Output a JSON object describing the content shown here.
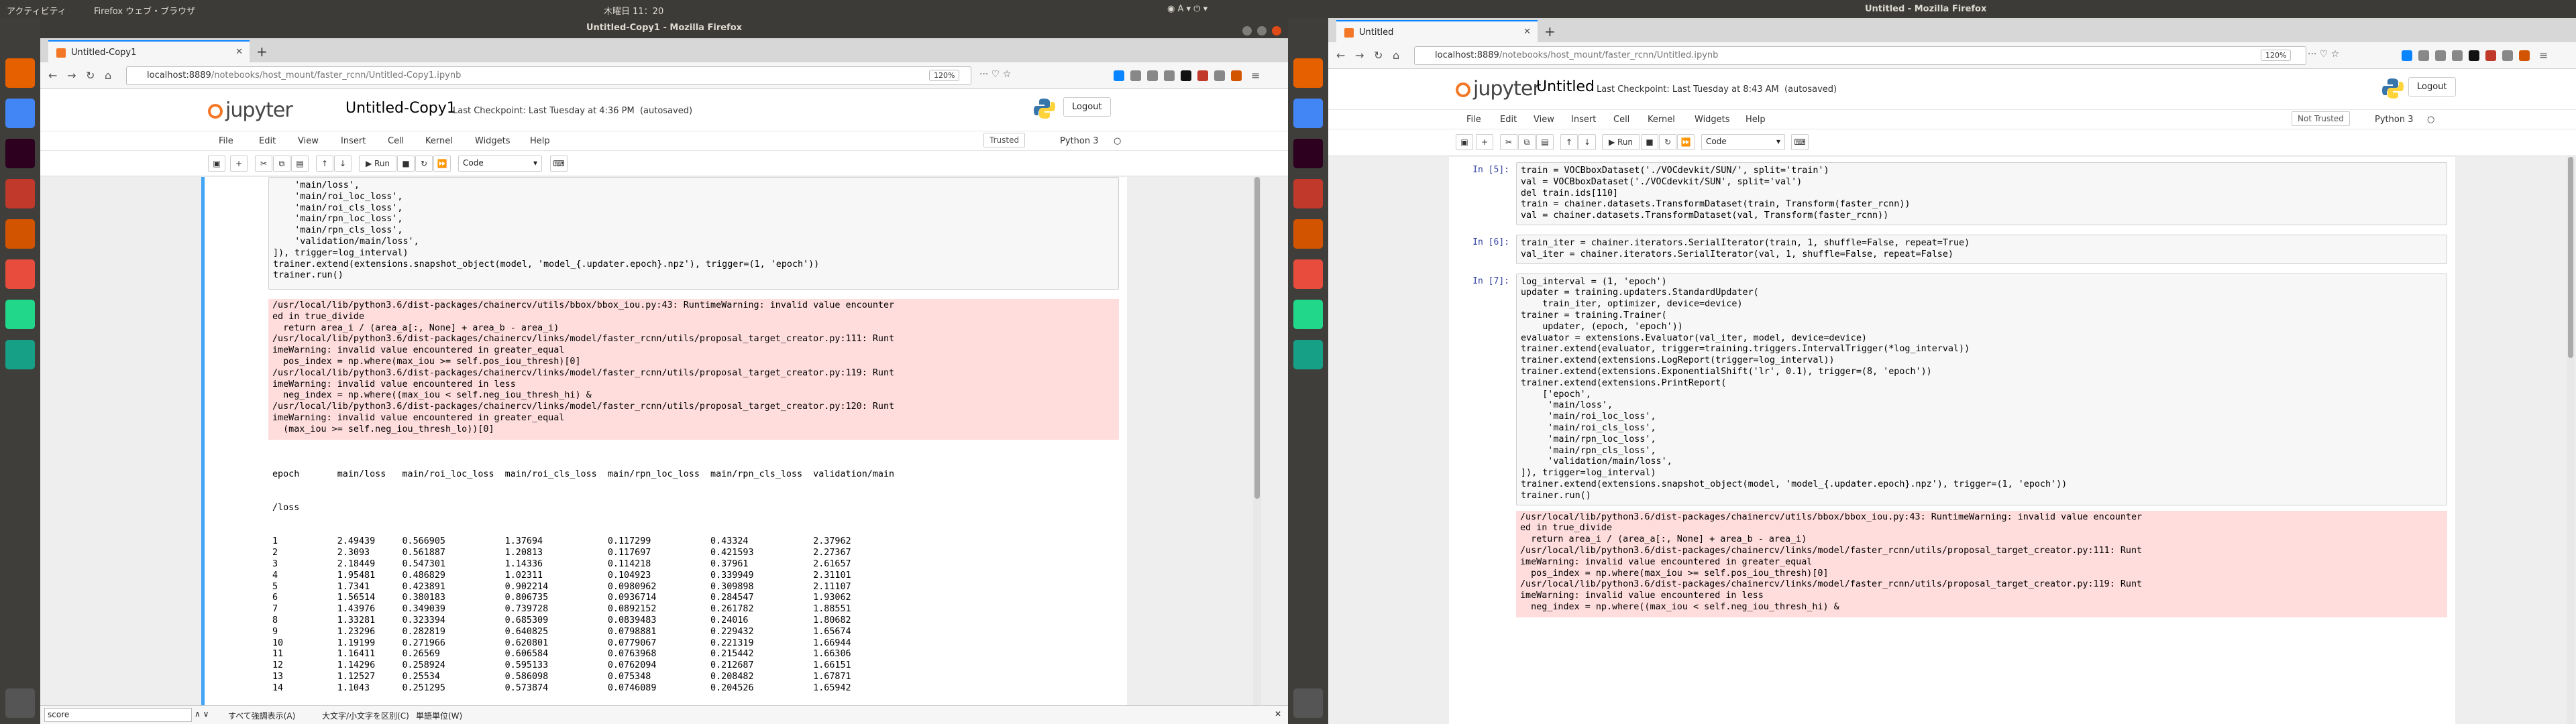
{
  "left": {
    "topbar": {
      "activities": "アクティビティ",
      "app": "Firefox ウェブ・ブラウザ",
      "clock": "木曜日 11：20"
    },
    "window_title": "Untitled-Copy1 - Mozilla Firefox",
    "tab_title": "Untitled-Copy1",
    "url_host": "localhost:8889",
    "url_path": "/notebooks/host_mount/faster_rcnn/Untitled-Copy1.ipynb",
    "zoom": "120%",
    "notebook_name": "Untitled-Copy1",
    "checkpoint": "Last Checkpoint: Last Tuesday at 4:36 PM",
    "autosaved": "(autosaved)",
    "logout": "Logout",
    "kernel_status": "Trusted",
    "kernel_name": "Python 3",
    "cell_type": "Code",
    "run_label": "Run",
    "code_lines": [
      "    'main/loss',",
      "    'main/roi_loc_loss',",
      "    'main/roi_cls_loss',",
      "    'main/rpn_loc_loss',",
      "    'main/rpn_cls_loss',",
      "    'validation/main/loss',",
      "]), trigger=log_interval)",
      "trainer.extend(extensions.snapshot_object(model, 'model_{.updater.epoch}.npz'), trigger=(1, 'epoch'))",
      "trainer.run()"
    ],
    "stderr_lines": [
      "/usr/local/lib/python3.6/dist-packages/chainercv/utils/bbox/bbox_iou.py:43: RuntimeWarning: invalid value encounter",
      "ed in true_divide",
      "  return area_i / (area_a[:, None] + area_b - area_i)",
      "/usr/local/lib/python3.6/dist-packages/chainercv/links/model/faster_rcnn/utils/proposal_target_creator.py:111: Runt",
      "imeWarning: invalid value encountered in greater_equal",
      "  pos_index = np.where(max_iou >= self.pos_iou_thresh)[0]",
      "/usr/local/lib/python3.6/dist-packages/chainercv/links/model/faster_rcnn/utils/proposal_target_creator.py:119: Runt",
      "imeWarning: invalid value encountered in less",
      "  neg_index = np.where((max_iou < self.neg_iou_thresh_hi) &",
      "/usr/local/lib/python3.6/dist-packages/chainercv/links/model/faster_rcnn/utils/proposal_target_creator.py:120: Runt",
      "imeWarning: invalid value encountered in greater_equal",
      "  (max_iou >= self.neg_iou_thresh_lo))[0]"
    ],
    "table_header": "epoch       main/loss   main/roi_loc_loss  main/roi_cls_loss  main/rpn_loc_loss  main/rpn_cls_loss  validation/main",
    "table_header2": "/loss",
    "table_rows": [
      "1           2.49439     0.566905           1.37694            0.117299           0.43324            2.37962",
      "2           2.3093      0.561887           1.20813            0.117697           0.421593           2.27367",
      "3           2.18449     0.547301           1.14336            0.114218           0.37961            2.61657",
      "4           1.95481     0.486829           1.02311            0.104923           0.339949           2.31101",
      "5           1.7341      0.423891           0.902214           0.0980962          0.309898           2.11107",
      "6           1.56514     0.380183           0.806735           0.0936714          0.284547           1.93062",
      "7           1.43976     0.349039           0.739728           0.0892152          0.261782           1.88551",
      "8           1.33281     0.323394           0.685309           0.0839483          0.24016            1.80682",
      "9           1.23296     0.282819           0.640825           0.0798881          0.229432           1.65674",
      "10          1.19199     0.271966           0.620801           0.0779067          0.221319           1.66944",
      "11          1.16411     0.26569            0.606584           0.0763968          0.215442           1.66306",
      "12          1.14296     0.258924           0.595133           0.0762094          0.212687           1.66151",
      "13          1.12527     0.25534            0.586098           0.075348           0.208482           1.67871",
      "14          1.1043      0.251295           0.573874           0.0746089          0.204526           1.65942"
    ],
    "find": {
      "value": "score",
      "highlight_all": "すべて強調表示(A)",
      "match_case": "大文字/小文字を区別(C)",
      "whole_words": "単語単位(W)"
    },
    "menu": [
      "File",
      "Edit",
      "View",
      "Insert",
      "Cell",
      "Kernel",
      "Widgets",
      "Help"
    ]
  },
  "right": {
    "topbar": {
      "title": "Untitled - Mozilla Firefox"
    },
    "window_title": "Untitled - Mozilla Firefox",
    "tab_title": "Untitled",
    "url_host": "localhost:8889",
    "url_path": "/notebooks/host_mount/faster_rcnn/Untitled.ipynb",
    "zoom": "120%",
    "notebook_name": "Untitled",
    "checkpoint": "Last Checkpoint: Last Tuesday at 8:43 AM",
    "autosaved": "(autosaved)",
    "logout": "Logout",
    "trust": "Not Trusted",
    "kernel_name": "Python 3",
    "cell_type": "Code",
    "run_label": "Run",
    "menu": [
      "File",
      "Edit",
      "View",
      "Insert",
      "Cell",
      "Kernel",
      "Widgets",
      "Help"
    ],
    "cells": [
      {
        "prompt": "In [5]:",
        "lines": [
          "train = VOCBboxDataset('./VOCdevkit/SUN/', split='train')",
          "val = VOCBboxDataset('./VOCdevkit/SUN', split='val')",
          "del train.ids[110]",
          "train = chainer.datasets.TransformDataset(train, Transform(faster_rcnn))",
          "val = chainer.datasets.TransformDataset(val, Transform(faster_rcnn))"
        ]
      },
      {
        "prompt": "In [6]:",
        "lines": [
          "train_iter = chainer.iterators.SerialIterator(train, 1, shuffle=False, repeat=True)",
          "val_iter = chainer.iterators.SerialIterator(val, 1, shuffle=False, repeat=False)"
        ]
      },
      {
        "prompt": "In [7]:",
        "lines": [
          "log_interval = (1, 'epoch')",
          "updater = training.updaters.StandardUpdater(",
          "    train_iter, optimizer, device=device)",
          "trainer = training.Trainer(",
          "    updater, (epoch, 'epoch'))",
          "evaluator = extensions.Evaluator(val_iter, model, device=device)",
          "trainer.extend(evaluator, trigger=training.triggers.IntervalTrigger(*log_interval))",
          "trainer.extend(extensions.LogReport(trigger=log_interval))",
          "trainer.extend(extensions.ExponentialShift('lr', 0.1), trigger=(8, 'epoch'))",
          "trainer.extend(extensions.PrintReport(",
          "    ['epoch',",
          "     'main/loss',",
          "     'main/roi_loc_loss',",
          "     'main/roi_cls_loss',",
          "     'main/rpn_loc_loss',",
          "     'main/rpn_cls_loss',",
          "     'validation/main/loss',",
          "]), trigger=log_interval)",
          "trainer.extend(extensions.snapshot_object(model, 'model_{.updater.epoch}.npz'), trigger=(1, 'epoch'))",
          "trainer.run()"
        ]
      }
    ],
    "stderr_lines": [
      "/usr/local/lib/python3.6/dist-packages/chainercv/utils/bbox/bbox_iou.py:43: RuntimeWarning: invalid value encounter",
      "ed in true_divide",
      "  return area_i / (area_a[:, None] + area_b - area_i)",
      "/usr/local/lib/python3.6/dist-packages/chainercv/links/model/faster_rcnn/utils/proposal_target_creator.py:111: Runt",
      "imeWarning: invalid value encountered in greater_equal",
      "  pos_index = np.where(max_iou >= self.pos_iou_thresh)[0]",
      "/usr/local/lib/python3.6/dist-packages/chainercv/links/model/faster_rcnn/utils/proposal_target_creator.py:119: Runt",
      "imeWarning: invalid value encountered in less",
      "  neg_index = np.where((max_iou < self.neg_iou_thresh_hi) &"
    ]
  },
  "colors": {
    "accent": "#f37726",
    "stderr_bg": "#ffdddd",
    "prompt": "#303f9f",
    "ubuntu_close": "#df4a16"
  }
}
